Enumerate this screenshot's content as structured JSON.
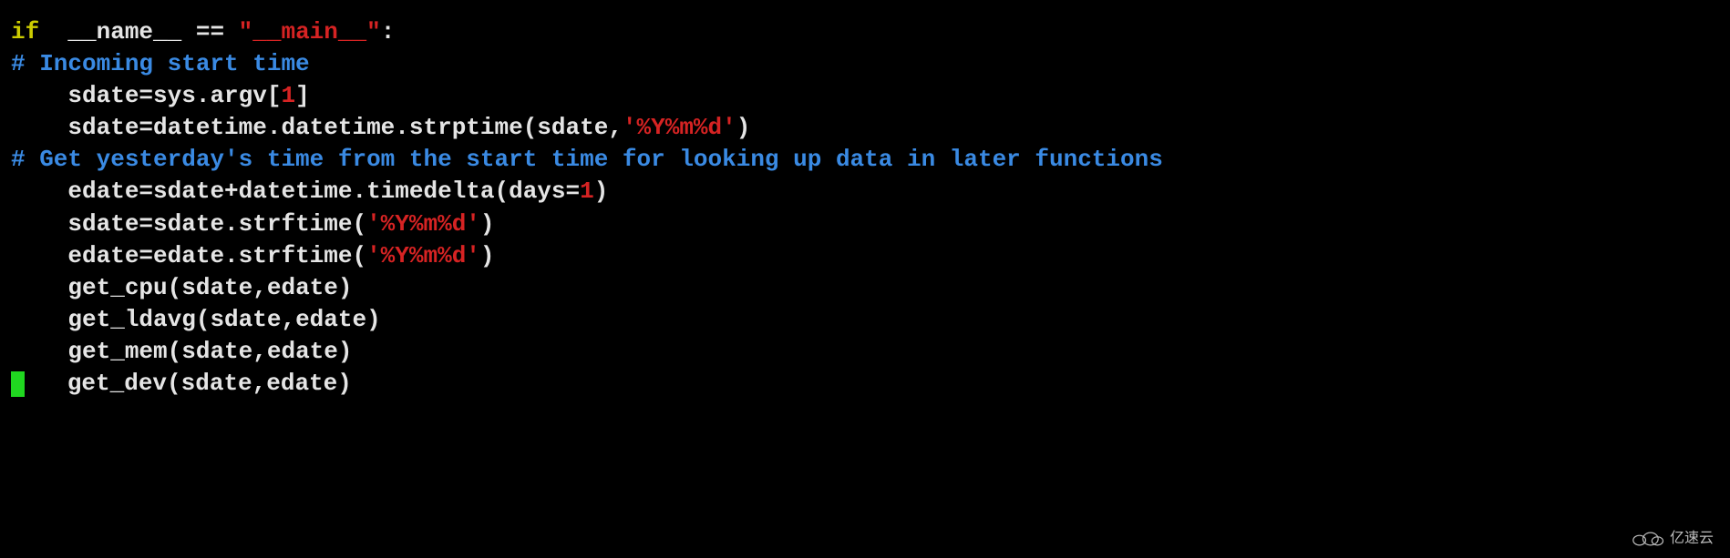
{
  "code": {
    "line1": {
      "kw": "if",
      "mid": "  __name__ == ",
      "str": "\"__main__\"",
      "tail": ":"
    },
    "line2": {
      "comment": "# Incoming start time"
    },
    "line3": {
      "indent": "    ",
      "a": "sdate=sys.argv[",
      "num": "1",
      "b": "]"
    },
    "line4": {
      "indent": "    ",
      "a": "sdate=datetime.datetime.strptime(sdate,",
      "str": "'%Y%m%d'",
      "b": ")"
    },
    "line5": {
      "comment": "# Get yesterday's time from the start time for looking up data in later functions"
    },
    "line6": {
      "indent": "    ",
      "a": "edate=sdate+datetime.timedelta(days=",
      "num": "1",
      "b": ")"
    },
    "line7": {
      "indent": "    ",
      "a": "sdate=sdate.strftime(",
      "str": "'%Y%m%d'",
      "b": ")"
    },
    "line8": {
      "indent": "    ",
      "a": "edate=edate.strftime(",
      "str": "'%Y%m%d'",
      "b": ")"
    },
    "line9": {
      "indent": "    ",
      "a": "get_cpu(sdate,edate)"
    },
    "line10": {
      "indent": "    ",
      "a": "get_ldavg(sdate,edate)"
    },
    "line11": {
      "indent": "    ",
      "a": "get_mem(sdate,edate)"
    },
    "line12": {
      "indent": "    ",
      "a": "get_dev(sdate,edate)"
    }
  },
  "watermark": "亿速云"
}
